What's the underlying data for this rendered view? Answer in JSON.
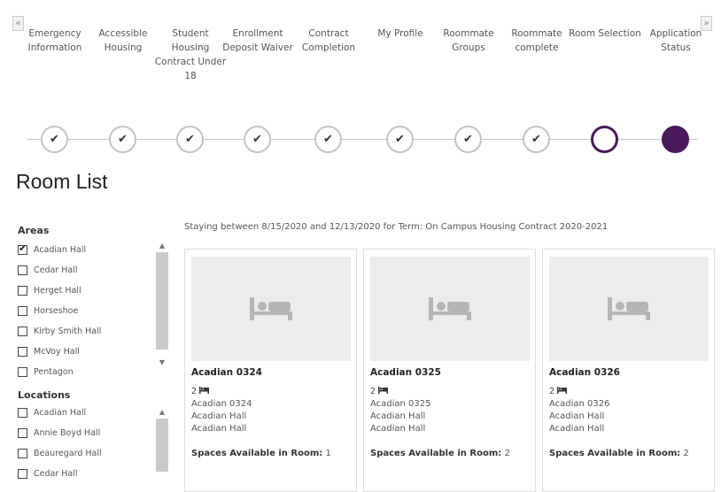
{
  "stepper": {
    "prev_label": "«",
    "next_label": "»",
    "check_glyph": "✔",
    "steps": [
      {
        "label": "Emergency Information",
        "state": "done"
      },
      {
        "label": "Accessible Housing",
        "state": "done"
      },
      {
        "label": "Student Housing Contract Under 18",
        "state": "done"
      },
      {
        "label": "Enrollment Deposit Waiver",
        "state": "done"
      },
      {
        "label": "Contract Completion",
        "state": "done"
      },
      {
        "label": "My Profile",
        "state": "done"
      },
      {
        "label": "Roommate Groups",
        "state": "done"
      },
      {
        "label": "Roommate complete",
        "state": "done"
      },
      {
        "label": "Room Selection",
        "state": "current"
      },
      {
        "label": "Application Status",
        "state": "upcoming"
      }
    ]
  },
  "page_title": "Room List",
  "stay_info": "Staying between 8/15/2020 and 12/13/2020 for Term: On Campus Housing Contract 2020-2021",
  "filters": {
    "areas_title": "Areas",
    "areas": [
      {
        "label": "Acadian Hall",
        "checked": true
      },
      {
        "label": "Cedar Hall",
        "checked": false
      },
      {
        "label": "Herget Hall",
        "checked": false
      },
      {
        "label": "Horseshoe",
        "checked": false
      },
      {
        "label": "Kirby Smith Hall",
        "checked": false
      },
      {
        "label": "McVoy Hall",
        "checked": false
      },
      {
        "label": "Pentagon",
        "checked": false
      }
    ],
    "locations_title": "Locations",
    "locations": [
      {
        "label": "Acadian Hall",
        "checked": false
      },
      {
        "label": "Annie Boyd Hall",
        "checked": false
      },
      {
        "label": "Beauregard Hall",
        "checked": false
      },
      {
        "label": "Cedar Hall",
        "checked": false
      }
    ],
    "scroll_up": "▲",
    "scroll_down": "▼"
  },
  "rooms": {
    "spaces_label": "Spaces Available in Room:",
    "items": [
      {
        "name": "Acadian 0324",
        "capacity": "2",
        "room": "Acadian 0324",
        "building": "Acadian Hall",
        "area": "Acadian Hall",
        "spaces": "1"
      },
      {
        "name": "Acadian 0325",
        "capacity": "2",
        "room": "Acadian 0325",
        "building": "Acadian Hall",
        "area": "Acadian Hall",
        "spaces": "2"
      },
      {
        "name": "Acadian 0326",
        "capacity": "2",
        "room": "Acadian 0326",
        "building": "Acadian Hall",
        "area": "Acadian Hall",
        "spaces": "2"
      }
    ]
  },
  "colors": {
    "accent": "#4a1a5c",
    "step_border": "#c4c4c4",
    "card_image_bg": "#ececec",
    "bed_icon": "#b5b5b5"
  }
}
